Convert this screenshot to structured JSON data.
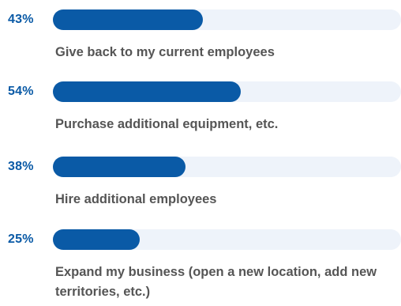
{
  "colors": {
    "fill": "#0a5aa6",
    "track": "#eef3fa",
    "percent": "#0a5aa6",
    "label": "#555555"
  },
  "chart_data": {
    "type": "bar",
    "orientation": "horizontal",
    "categories": [
      "Give back to my current employees",
      "Purchase additional equipment, etc.",
      "Hire additional employees",
      "Expand my business (open a new location, add new territories, etc.)"
    ],
    "values": [
      43,
      54,
      38,
      25
    ],
    "value_labels": [
      "43%",
      "54%",
      "38%",
      "25%"
    ],
    "xlim": [
      0,
      100
    ],
    "grid": false,
    "legend": "none"
  }
}
